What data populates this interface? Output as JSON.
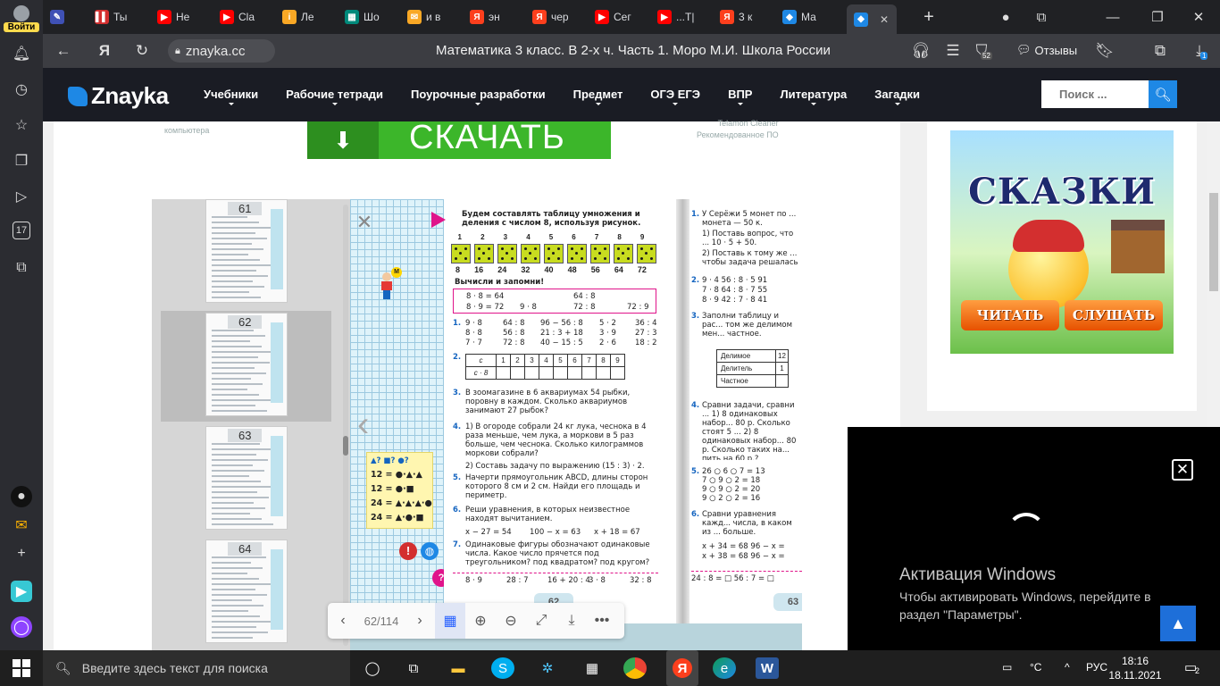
{
  "sidepanel": {
    "login_label": "Войти"
  },
  "tabs": [
    {
      "label": "Ты",
      "fav": "▌▌",
      "color": "#d32f2f"
    },
    {
      "label": "Не",
      "fav": "▶",
      "color": "#ff0000"
    },
    {
      "label": "Cla",
      "fav": "▶",
      "color": "#ff0000"
    },
    {
      "label": "Ле",
      "fav": "i",
      "color": "#f9a825"
    },
    {
      "label": "Шо",
      "fav": "▦",
      "color": "#00897b"
    },
    {
      "label": "и в",
      "fav": "✉",
      "color": "#f9a825"
    },
    {
      "label": "эн",
      "fav": "Я",
      "color": "#fc3f1d"
    },
    {
      "label": "чер",
      "fav": "Я",
      "color": "#fc3f1d"
    },
    {
      "label": "Сег",
      "fav": "▶",
      "color": "#ff0000"
    },
    {
      "label": "...Т|",
      "fav": "▶",
      "color": "#ff0000"
    },
    {
      "label": "3 к",
      "fav": "Я",
      "color": "#fc3f1d"
    },
    {
      "label": "Ма",
      "fav": "◆",
      "color": "#1e88e5"
    }
  ],
  "addressbar": {
    "domain": "znayka.cc",
    "page_title": "Математика 3 класс. В 2-х ч. Часть 1. Моро М.И. Школа России",
    "reviews_label": "Отзывы",
    "tab_count_badge": "52",
    "download_badge": "1"
  },
  "site": {
    "logo_text": "Znayka",
    "menu": [
      "Учебники",
      "Рабочие тетради",
      "Поурочные разработки",
      "Предмет",
      "ОГЭ ЕГЭ",
      "ВПР",
      "Литература",
      "Загадки"
    ],
    "search_placeholder": "Поиск ..."
  },
  "ad": {
    "left_text": "компьютера",
    "right_line1": "Telamon Cleaner",
    "right_line2": "Рекомендованное ПО",
    "download_label": "СКАЧАТЬ"
  },
  "viewer": {
    "thumbnails": [
      "61",
      "62",
      "63",
      "64"
    ],
    "page_input": "62/114",
    "left_page_number": "62",
    "right_page_number": "63",
    "left_page": {
      "intro": "Будем составлять таблицу умножения и деления с числом 8, используя рисунок.",
      "dice_top": [
        "1",
        "2",
        "3",
        "4",
        "5",
        "6",
        "7",
        "8",
        "9"
      ],
      "dice_bottom": [
        "8",
        "16",
        "24",
        "32",
        "40",
        "48",
        "56",
        "64",
        "72"
      ],
      "memorize": "Вычисли и запомни!",
      "box_row1": [
        "8 · 8 = 64",
        "64 : 8"
      ],
      "box_row2": [
        "8 · 9 = 72",
        "9 · 8",
        "72 : 8",
        "72 : 9"
      ],
      "task1": [
        [
          "9 · 8",
          "64 : 8",
          "96 − 56 : 8",
          "5 · 2",
          "36 : 4"
        ],
        [
          "8 · 8",
          "56 : 8",
          "21 : 3 + 18",
          "3 · 9",
          "27 : 3"
        ],
        [
          "7 · 7",
          "72 : 8",
          "40 − 15 : 5",
          "2 · 6",
          "18 : 2"
        ]
      ],
      "task2_row1": [
        "c",
        "1",
        "2",
        "3",
        "4",
        "5",
        "6",
        "7",
        "8",
        "9"
      ],
      "task2_row2_label": "c · 8",
      "task3": "В зоомагазине в 6 аквариумах 54 рыбки, поровну в каждом. Сколько аквариумов занимают 27 рыбок?",
      "task4": "1) В огороде собрали 24 кг лука, чеснока в 4 раза меньше, чем лука, а моркови в 5 раз больше, чем чеснока. Сколько килограммов моркови собрали?",
      "task4b": "2) Составь задачу по выражению (15 : 3) · 2.",
      "task5": "Начерти прямоугольник ABCD, длины сторон которого 8 см и 2 см. Найди его площадь и периметр.",
      "task6": "Реши уравнения, в которых неизвестное находят вычитанием.",
      "task6_eq": [
        "x − 27 = 54",
        "100 − x = 63",
        "x + 18 = 67"
      ],
      "task7": "Одинаковые фигуры обозначают одинаковые числа. Какое число прячется под треугольником? под квадратом? под кругом?",
      "bottom_row": [
        "8 · 9",
        "28 : 7",
        "16 + 20 : 4",
        "3 · 8",
        "32 : 8"
      ],
      "puzzle_head": "▲? ■? ●?",
      "puzzle": [
        "12 = ●·▲·▲",
        "12 = ●·■",
        "24 = ▲·▲·▲·●",
        "24 = ▲·●·■"
      ]
    },
    "right_page": {
      "task1": "У Серёжи 5 монет по ... монета — 50 к.",
      "task1a": "1) Поставь вопрос, что ... 10 · 5 + 50.",
      "task1b": "2) Поставь к тому же ... чтобы задача решалась",
      "task2": [
        "9 · 4   56 : 8 · 5   91",
        "7 · 8   64 : 8 · 7   55",
        "8 · 9   42 : 7 · 8   41"
      ],
      "task3": "Заполни таблицу и рас... том же делимом мен... частное.",
      "table_rows": [
        [
          "Делимое",
          "12"
        ],
        [
          "Делитель",
          "1"
        ],
        [
          "Частное",
          ""
        ]
      ],
      "task4": "Сравни задачи, сравни ... 1) 8 одинаковых набор... 80 р. Сколько стоят 5 ... 2) 8 одинаковых набор... 80 р. Сколько таких на... пить на 60 р.?",
      "task5": [
        "26 ○ 6 ○ 7 = 13",
        "7 ○ 9 ○ 2 = 18",
        "9 ○ 9 ○ 2 = 20",
        "9 ○ 2 ○ 2 = 16"
      ],
      "task6": "Сравни уравнения кажд... числа, в каком из ... больше.",
      "task6_eq": [
        "x + 34 = 68   96 − x =",
        "x + 38 = 68   96 − x ="
      ],
      "bottom": "24 : 8 = □     56 : 7 = □"
    }
  },
  "sidebar_ad": {
    "title": "СКАЗКИ",
    "read_label": "ЧИТАТЬ",
    "listen_label": "СЛУШАТЬ"
  },
  "video_overlay": {
    "activation_title": "Активация Windows",
    "activation_sub": "Чтобы активировать Windows, перейдите в раздел \"Параметры\"."
  },
  "taskbar": {
    "search_placeholder": "Введите здесь текст для поиска",
    "weather": "°C",
    "lang": "РУС",
    "time": "18:16",
    "date": "18.11.2021",
    "notif_count": "2"
  }
}
